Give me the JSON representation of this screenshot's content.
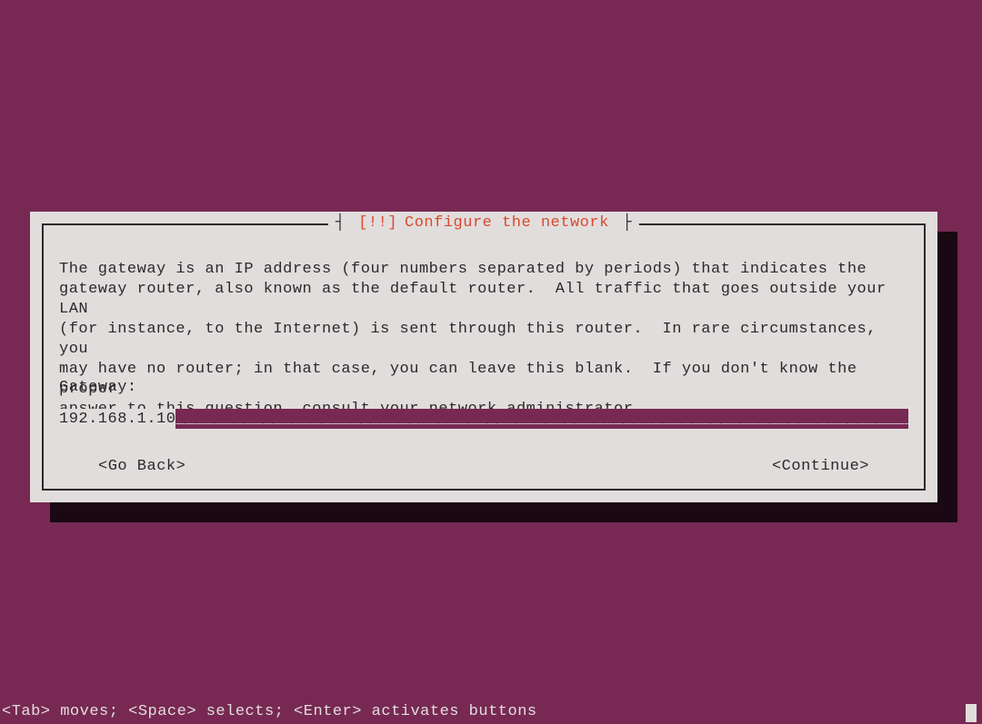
{
  "dialog": {
    "title_marker": "[!!]",
    "title_text": "Configure the network",
    "body": "The gateway is an IP address (four numbers separated by periods) that indicates the\ngateway router, also known as the default router.  All traffic that goes outside your LAN\n(for instance, to the Internet) is sent through this router.  In rare circumstances, you\nmay have no router; in that case, you can leave this blank.  If you don't know the proper\nanswer to this question, consult your network administrator.",
    "field_label": "Gateway:",
    "input_value": "192.168.1.10",
    "go_back_label": "<Go Back>",
    "continue_label": "<Continue>"
  },
  "status_bar": "<Tab> moves; <Space> selects; <Enter> activates buttons"
}
